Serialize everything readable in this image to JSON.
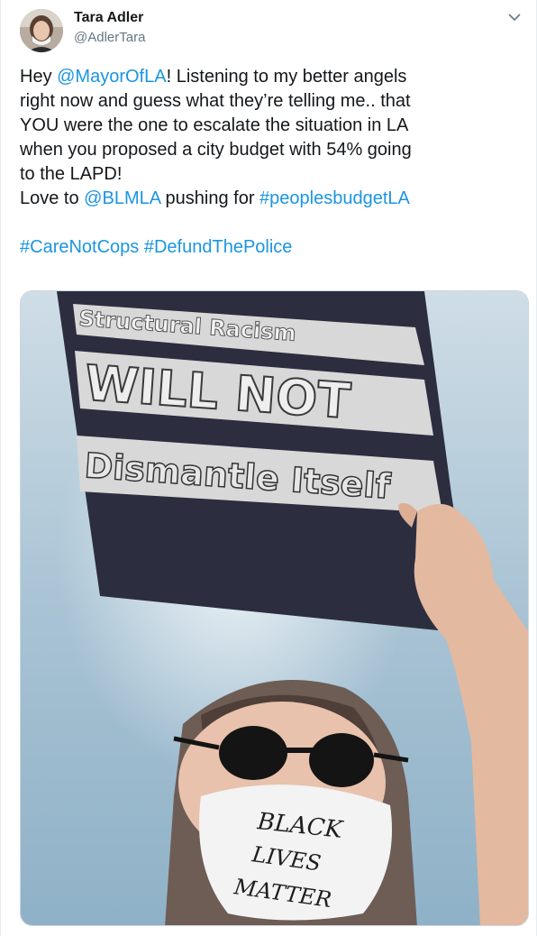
{
  "tweet": {
    "author": {
      "display_name": "Tara Adler",
      "handle": "@AdlerTara",
      "avatar_icon": "avatar-photo"
    },
    "menu_icon": "chevron-down-icon",
    "text": {
      "l1_pre": "Hey ",
      "l1_mention": "@MayorOfLA",
      "l1_post": "! Listening to my better angels",
      "l2": "right now and guess what they’re telling me.. that",
      "l3": "YOU were the one to escalate the situation in LA",
      "l4": "when you proposed a city budget with 54% going",
      "l5": "to the LAPD!",
      "l6_pre": "Love to ",
      "l6_mention": "@BLMLA",
      "l6_mid": " pushing for ",
      "l6_hashtag": "#peoplesbudgetLA",
      "h1": "#CareNotCops",
      "h2": "#DefundThePolice"
    },
    "media": {
      "sign_line1": "Structural Racism",
      "sign_line2": "WILL NOT",
      "sign_line3": "Dismantle Itself",
      "mask_line1": "BLACK",
      "mask_line2": "LIVES",
      "mask_line3": "MATTER"
    },
    "colors": {
      "link": "#1b95e0",
      "handle": "#657786",
      "text": "#14171a",
      "sky": "#a9c6d8"
    }
  }
}
